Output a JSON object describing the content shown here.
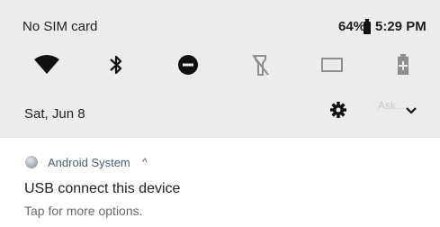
{
  "status_bar": {
    "carrier": "No SIM card",
    "battery_percent": "64%",
    "time": "5:29 PM"
  },
  "quick_settings": {
    "tiles": [
      {
        "icon": "wifi-icon"
      },
      {
        "icon": "bluetooth-icon"
      },
      {
        "icon": "do-not-disturb-icon"
      },
      {
        "icon": "flashlight-off-icon"
      },
      {
        "icon": "cast-icon"
      },
      {
        "icon": "battery-saver-icon"
      }
    ],
    "date": "Sat, Jun 8",
    "faint_text": "Ask..."
  },
  "notification": {
    "app_name": "Android System",
    "caret": "^",
    "title": "USB connect this device",
    "body": "Tap for more options."
  }
}
